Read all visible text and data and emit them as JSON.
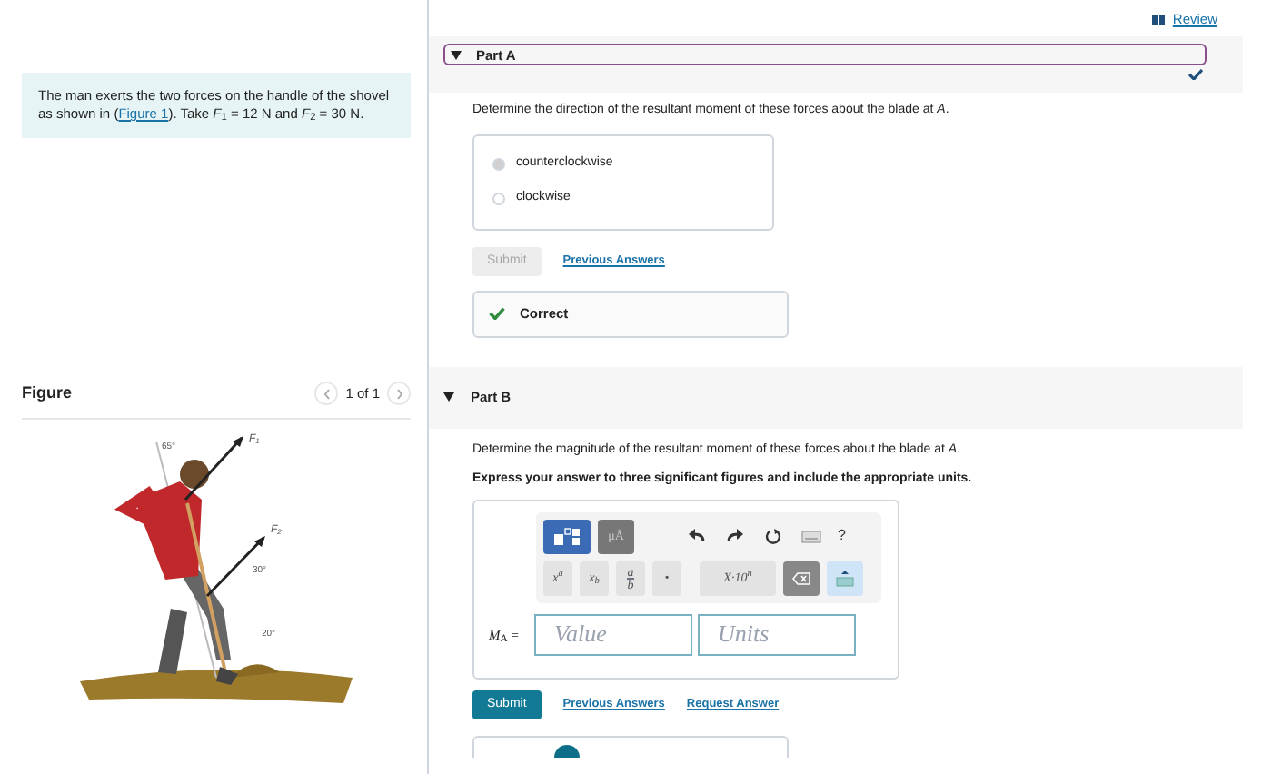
{
  "review_link": "Review",
  "intro": {
    "before": "The man exerts the two forces on the handle of the shovel as shown in (",
    "link": "Figure 1",
    "after": "). Take *F*$_{1}$ = 12 N and *F*$_{2}$ = 30 N."
  },
  "figure": {
    "title": "Figure",
    "pager": "1 of 1",
    "labels": [
      "65°",
      "F$_{1}$",
      "F$_{2}$",
      "30°",
      "20°"
    ]
  },
  "part_a": {
    "title": "Part A",
    "expanded": true,
    "correct": true,
    "question": "Determine the direction of the resultant moment of these forces about the blade at *A*.",
    "options": [
      {
        "label": "counterclockwise",
        "selected": true
      },
      {
        "label": "clockwise",
        "selected": false
      }
    ],
    "submit": {
      "label": "Submit",
      "disabled": true
    },
    "links": [
      "Previous Answers"
    ],
    "feedback": "Correct"
  },
  "part_b": {
    "title": "Part B",
    "expanded": true,
    "question": "Determine the magnitude of the resultant moment of these forces about the blade at *A*.",
    "instruction": "Express your answer to three significant figures and include the appropriate units.",
    "toolbar_top": [
      {
        "kind": "templates"
      },
      {
        "kind": "text",
        "label": "μÅ"
      },
      {
        "kind": "undo"
      },
      {
        "kind": "redo"
      },
      {
        "kind": "reset"
      },
      {
        "kind": "keyboard"
      },
      {
        "kind": "help",
        "label": "?"
      }
    ],
    "toolbar_bottom": [
      {
        "kind": "text",
        "label": "x$^{a}$"
      },
      {
        "kind": "text",
        "label": "x$_{b}$"
      },
      {
        "kind": "fraction",
        "label": "a",
        "label2": "b"
      },
      {
        "kind": "text",
        "label": "•"
      },
      {
        "kind": "wide",
        "label": "X·10$^{n}$"
      },
      {
        "kind": "backspace"
      },
      {
        "kind": "keyboard-up"
      }
    ],
    "variable": "*M*$_{A}$ =",
    "value_placeholder": "Value",
    "units_placeholder": "Units",
    "submit": {
      "label": "Submit",
      "disabled": false
    },
    "links": [
      "Previous Answers",
      "Request Answer"
    ]
  }
}
